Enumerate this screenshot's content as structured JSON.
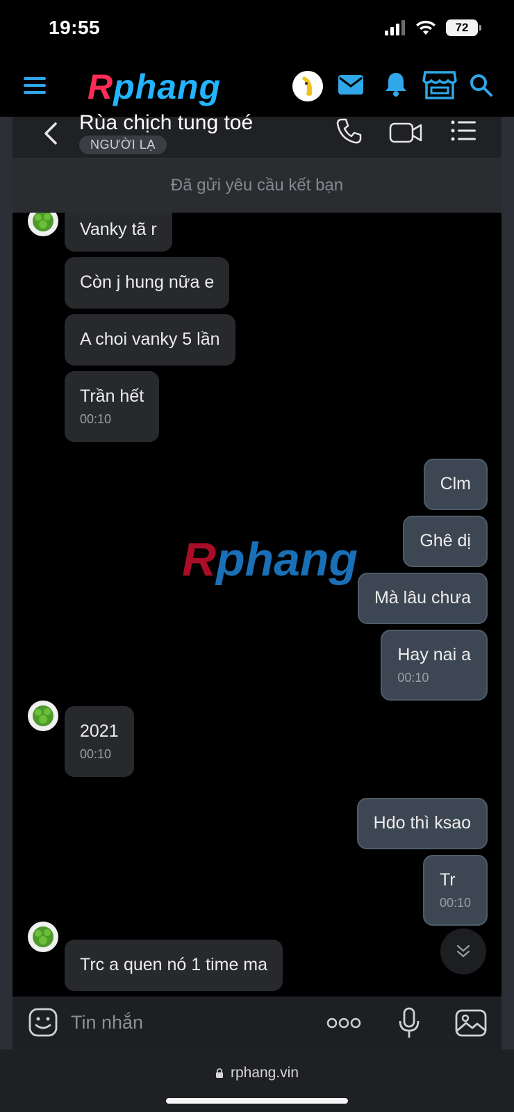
{
  "status_bar": {
    "time": "19:55",
    "battery": "72"
  },
  "site": {
    "logo_part1": "R",
    "logo_part2": "phang"
  },
  "chat_header": {
    "contact_name": "Rùa chịch tung toé",
    "badge": "NGƯỜI LẠ"
  },
  "friend_request": {
    "text": "Đã gửi yêu cầu kết bạn"
  },
  "messages": [
    {
      "dir": "in",
      "text": "Vanky tã r"
    },
    {
      "dir": "in",
      "text": "Còn j hung nữa e"
    },
    {
      "dir": "in",
      "text": "A choi vanky 5 lần"
    },
    {
      "dir": "in",
      "text": "Trần hết",
      "time": "00:10"
    },
    {
      "dir": "out",
      "text": "Clm"
    },
    {
      "dir": "out",
      "text": "Ghê dị"
    },
    {
      "dir": "out",
      "text": "Mà lâu chưa"
    },
    {
      "dir": "out",
      "text": "Hay nai a",
      "time": "00:10"
    },
    {
      "dir": "in",
      "text": "2021",
      "time": "00:10"
    },
    {
      "dir": "out",
      "text": "Hdo thì ksao"
    },
    {
      "dir": "out",
      "text": "Tr",
      "time": "00:10"
    },
    {
      "dir": "in",
      "text": "Trc a quen nó 1 time ma"
    }
  ],
  "watermark": {
    "part1": "R",
    "part2": "phang"
  },
  "composer": {
    "placeholder": "Tin nhắn"
  },
  "browser": {
    "url": "rphang.vin"
  },
  "colors": {
    "accent_blue": "#2fa7e8",
    "incoming_bubble": "#27292c",
    "outgoing_bubble": "#3d4753"
  }
}
